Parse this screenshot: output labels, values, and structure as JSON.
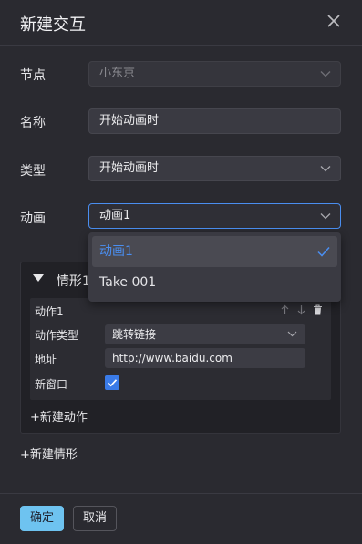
{
  "dialog": {
    "title": "新建交互"
  },
  "form": {
    "node": {
      "label": "节点",
      "value": "小东京"
    },
    "name": {
      "label": "名称",
      "value": "开始动画时"
    },
    "type": {
      "label": "类型",
      "value": "开始动画时"
    },
    "animation": {
      "label": "动画",
      "value": "动画1",
      "options": [
        "动画1",
        "Take 001"
      ]
    }
  },
  "case": {
    "label": "情形1",
    "action": {
      "title": "动作1",
      "type_label": "动作类型",
      "type_value": "跳转链接",
      "url_label": "地址",
      "url_value": "http://www.baidu.com",
      "new_window_label": "新窗口",
      "new_window_checked": true
    },
    "add_action": "+新建动作"
  },
  "add_case": "+新建情形",
  "footer": {
    "ok": "确定",
    "cancel": "取消"
  },
  "colors": {
    "accent": "#4a8ef0",
    "ok_button": "#6ec3f0",
    "background": "#2a2a30"
  }
}
